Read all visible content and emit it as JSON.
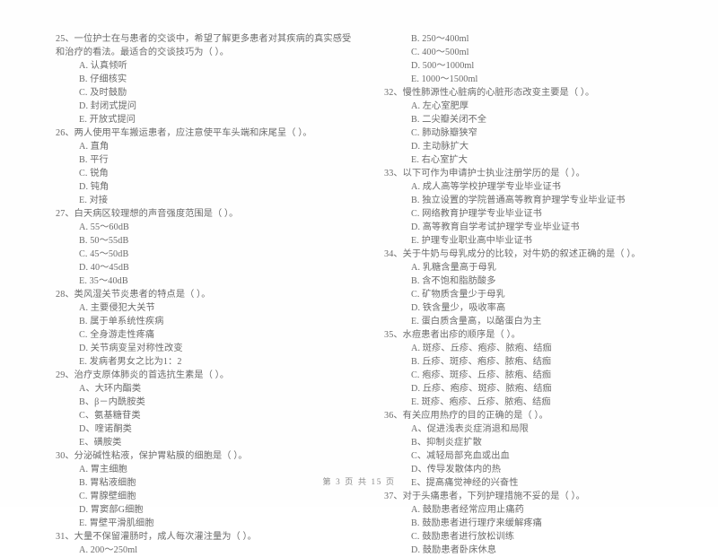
{
  "document": {
    "page_background": "#fefefe",
    "text_color": "#6b6b6b",
    "footer": "第 3 页 共 15 页"
  },
  "left_column": {
    "questions": [
      {
        "number": "25",
        "stem": "25、一位护士在与患者的交谈中，希望了解更多患者对其疾病的真实感受和治疗的看法。最适合的交谈技巧为（      ）。",
        "options": [
          "A. 认真倾听",
          "B. 仔细核实",
          "C. 及时鼓励",
          "D. 封闭式提问",
          "E. 开放式提问"
        ]
      },
      {
        "number": "26",
        "stem": "26、两人使用平车搬运患者，应注意使平车头端和床尾呈（      ）。",
        "options": [
          "A. 直角",
          "B. 平行",
          "C. 锐角",
          "D. 钝角",
          "E. 对接"
        ]
      },
      {
        "number": "27",
        "stem": "27、白天病区较理想的声音强度范围是（      ）。",
        "options": [
          "A. 55～60dB",
          "B. 50～55dB",
          "C. 45～50dB",
          "D. 40～45dB",
          "E. 35～40dB"
        ]
      },
      {
        "number": "28",
        "stem": "28、类风湿关节炎患者的特点是（      ）。",
        "options": [
          "A. 主要侵犯大关节",
          "B. 属于单系统性疾病",
          "C. 全身游走性疼痛",
          "D. 关节病变呈对称性改变",
          "E. 发病者男女之比为1：2"
        ]
      },
      {
        "number": "29",
        "stem": "29、治疗支原体肺炎的首选抗生素是（      ）。",
        "options": [
          "A、大环内酯类",
          "B、β－内酰胺类",
          "C、氨基糖苷类",
          "D、喹诺酮类",
          "E、磺胺类"
        ]
      },
      {
        "number": "30",
        "stem": "30、分泌碱性粘液，保护胃粘膜的细胞是（      ）。",
        "options": [
          "A. 胃主细胞",
          "B. 胃粘液细胞",
          "C. 胃腺壁细胞",
          "D. 胃窦部G细胞",
          "E. 胃壁平滑肌细胞"
        ]
      },
      {
        "number": "31",
        "stem": "31、大量不保留灌肠时，成人每次灌注量为（      ）。",
        "options": [
          "A. 200～250ml"
        ]
      }
    ]
  },
  "right_column": {
    "questions": [
      {
        "number": "31-cont",
        "stem": "",
        "options": [
          "B. 250～400ml",
          "C. 400～500ml",
          "D. 500～1000ml",
          "E. 1000～1500ml"
        ]
      },
      {
        "number": "32",
        "stem": "32、慢性肺源性心脏病的心脏形态改变主要是（      ）。",
        "options": [
          "A. 左心室肥厚",
          "B. 二尖瓣关闭不全",
          "C. 肺动脉瓣狭窄",
          "D. 主动脉扩大",
          "E. 右心室扩大"
        ]
      },
      {
        "number": "33",
        "stem": "33、以下可作为申请护士执业注册学历的是（      ）。",
        "options": [
          "A. 成人高等学校护理学专业毕业证书",
          "B. 独立设置的学院普通高等教育护理学专业毕业证书",
          "C. 网络教育护理学专业毕业证书",
          "D. 高等教育自学考试护理学专业毕业证书",
          "E. 护理专业职业高中毕业证书"
        ]
      },
      {
        "number": "34",
        "stem": "34、关于牛奶与母乳成分的比较，对牛奶的叙述正确的是（      ）。",
        "options": [
          "A. 乳糖含量高于母乳",
          "B. 含不饱和脂肪酸多",
          "C. 矿物质含量少于母乳",
          "D. 铁含量少，吸收率高",
          "E. 蛋白质含量高，以酪蛋白为主"
        ]
      },
      {
        "number": "35",
        "stem": "35、水痘患者出疹的顺序是（      ）。",
        "options": [
          "A. 斑疹、丘疹、疱疹、脓疱、结痂",
          "B. 丘疹、斑疹、疱疹、脓疱、结痂",
          "C. 疱疹、斑疹、丘疹、脓疱、结痂",
          "D. 丘疹、疱疹、斑疹、脓疱、结痂",
          "E. 斑疹、疱疹、丘疹、脓疱、结痂"
        ]
      },
      {
        "number": "36",
        "stem": "36、有关应用热疗的目的正确的是（      ）。",
        "options": [
          "A、促进浅表炎症消退和局限",
          "B、抑制炎症扩散",
          "C、减轻局部充血或出血",
          "D、传导发散体内的热",
          "E、提高痛觉神经的兴奋性"
        ]
      },
      {
        "number": "37",
        "stem": "37、对于头痛患者，下列护理措施不妥的是（      ）。",
        "options": [
          "A. 鼓励患者经常应用止痛药",
          "B. 鼓励患者进行理疗来缓解疼痛",
          "C. 鼓励患者进行放松训练",
          "D. 鼓励患者卧床休息"
        ]
      }
    ]
  }
}
